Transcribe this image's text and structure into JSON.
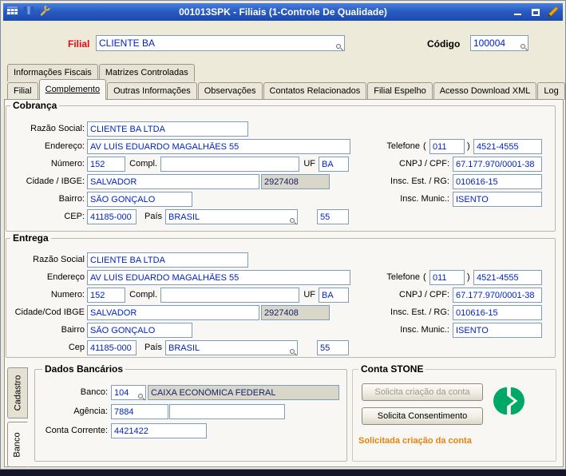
{
  "window": {
    "title": "001013SPK - Filiais (1-Controle De Qualidade)"
  },
  "header": {
    "filial_label": "Filial",
    "filial_value": "CLIENTE BA",
    "codigo_label": "Código",
    "codigo_value": "100004"
  },
  "tabs_row1": [
    {
      "label": "Informações Fiscais"
    },
    {
      "label": "Matrizes Controladas"
    }
  ],
  "tabs_row2": [
    {
      "label": "Filial"
    },
    {
      "label": "Complemento",
      "active": true
    },
    {
      "label": "Outras Informações"
    },
    {
      "label": "Observações"
    },
    {
      "label": "Contatos Relacionados"
    },
    {
      "label": "Filial Espelho"
    },
    {
      "label": "Acesso Download XML"
    },
    {
      "label": "Log"
    }
  ],
  "cobranca": {
    "title": "Cobrança",
    "labels": {
      "razao": "Razão Social:",
      "endereco": "Endereço:",
      "numero": "Número:",
      "compl": "Compl.",
      "uf": "UF",
      "cidade": "Cidade / IBGE:",
      "bairro": "Bairro:",
      "cep": "CEP:",
      "pais": "País",
      "telefone": "Telefone",
      "paren_open": "(",
      "paren_close": ")",
      "cnpj": "CNPJ / CPF:",
      "insc_est": "Insc. Est. / RG:",
      "insc_mun": "Insc. Munic.:"
    },
    "values": {
      "razao": "CLIENTE BA LTDA",
      "endereco": "AV LUÍS EDUARDO MAGALHÃES 55",
      "numero": "152",
      "compl": "",
      "uf": "BA",
      "cidade": "SALVADOR",
      "ibge": "2927408",
      "bairro": "SÃO GONÇALO",
      "cep": "41185-000",
      "pais": "BRASIL",
      "pais_cod": "55",
      "ddd": "011",
      "telefone": "4521-4555",
      "cnpj": "67.177.970/0001-38",
      "insc_est": "010616-15",
      "insc_mun": "ISENTO"
    }
  },
  "entrega": {
    "title": "Entrega",
    "labels": {
      "razao": "Razão Social",
      "endereco": "Endereço",
      "numero": "Numero:",
      "compl": "Compl.",
      "uf": "UF",
      "cidade": "Cidade/Cod IBGE",
      "bairro": "Bairro",
      "cep": "Cep",
      "pais": "País",
      "telefone": "Telefone",
      "paren_open": "(",
      "paren_close": ")",
      "cnpj": "CNPJ / CPF:",
      "insc_est": "Insc. Est. / RG:",
      "insc_mun": "Insc. Munic.:"
    },
    "values": {
      "razao": "CLIENTE BA LTDA",
      "endereco": "AV LUÍS EDUARDO MAGALHÃES 55",
      "numero": "152",
      "compl": "",
      "uf": "BA",
      "cidade": "SALVADOR",
      "ibge": "2927408",
      "bairro": "SÃO GONÇALO",
      "cep": "41185-000",
      "pais": "BRASIL",
      "pais_cod": "55",
      "ddd": "011",
      "telefone": "4521-4555",
      "cnpj": "67.177.970/0001-38",
      "insc_est": "010616-15",
      "insc_mun": "ISENTO"
    }
  },
  "side_tabs": [
    {
      "label": "Cadastro"
    },
    {
      "label": "Banco",
      "active": true
    }
  ],
  "dados_bancarios": {
    "title": "Dados Bancários",
    "labels": {
      "banco": "Banco:",
      "agencia": "Agência:",
      "conta": "Conta Corrente:"
    },
    "values": {
      "banco_cod": "104",
      "banco_nome": "CAIXA ECONÔMICA FEDERAL",
      "agencia": "7884",
      "agencia_extra": "",
      "conta": "4421422"
    }
  },
  "conta_stone": {
    "title": "Conta STONE",
    "btn_solicita_criacao": "Solicita criação da conta",
    "btn_solicita_consentimento": "Solicita Consentimento",
    "status": "Solicitada criação da conta"
  },
  "colors": {
    "titlebar_blue": "#2A5CC2",
    "field_text_blue": "#0023C9",
    "label_red": "#E30613",
    "status_orange": "#E8820C",
    "stone_green": "#00A868",
    "readonly_bg": "#D9D6CA"
  }
}
